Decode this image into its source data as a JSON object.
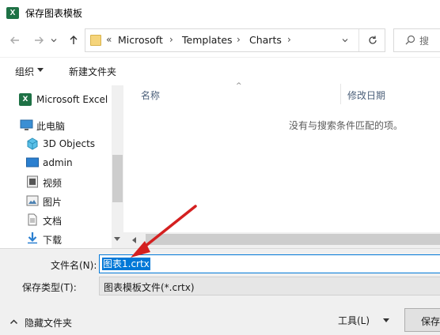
{
  "window": {
    "title": "保存图表模板",
    "app_icon": "excel-icon"
  },
  "navigation": {
    "back_icon": "arrow-left-icon",
    "forward_icon": "arrow-right-icon",
    "history_icon": "chevron-down-icon",
    "up_icon": "arrow-up-icon",
    "breadcrumb_prefix": "«",
    "breadcrumb": [
      "Microsoft",
      "Templates",
      "Charts"
    ],
    "search_placeholder": "搜"
  },
  "toolbar": {
    "organize_label": "组织",
    "new_folder_label": "新建文件夹"
  },
  "sidebar": {
    "items": [
      {
        "label": "Microsoft Excel",
        "icon": "excel-icon"
      },
      {
        "label": "此电脑",
        "icon": "computer-icon"
      },
      {
        "label": "3D Objects",
        "icon": "3d-objects-icon"
      },
      {
        "label": "admin",
        "icon": "desktop-folder-icon"
      },
      {
        "label": "视频",
        "icon": "video-folder-icon"
      },
      {
        "label": "图片",
        "icon": "pictures-folder-icon"
      },
      {
        "label": "文档",
        "icon": "documents-folder-icon"
      },
      {
        "label": "下载",
        "icon": "downloads-folder-icon"
      }
    ]
  },
  "filelist": {
    "columns": [
      "名称",
      "修改日期"
    ],
    "empty_message": "没有与搜索条件匹配的项。"
  },
  "form": {
    "filename_label": "文件名(N):",
    "filename_value": "图表1.crtx",
    "filetype_label": "保存类型(T):",
    "filetype_value": "图表模板文件(*.crtx)"
  },
  "footer": {
    "hide_folders_label": "隐藏文件夹",
    "tools_label": "工具(L)",
    "save_label": "保存"
  },
  "colors": {
    "accent": "#0078d7",
    "annotation_arrow": "#d42020",
    "excel_green": "#1e7145"
  }
}
